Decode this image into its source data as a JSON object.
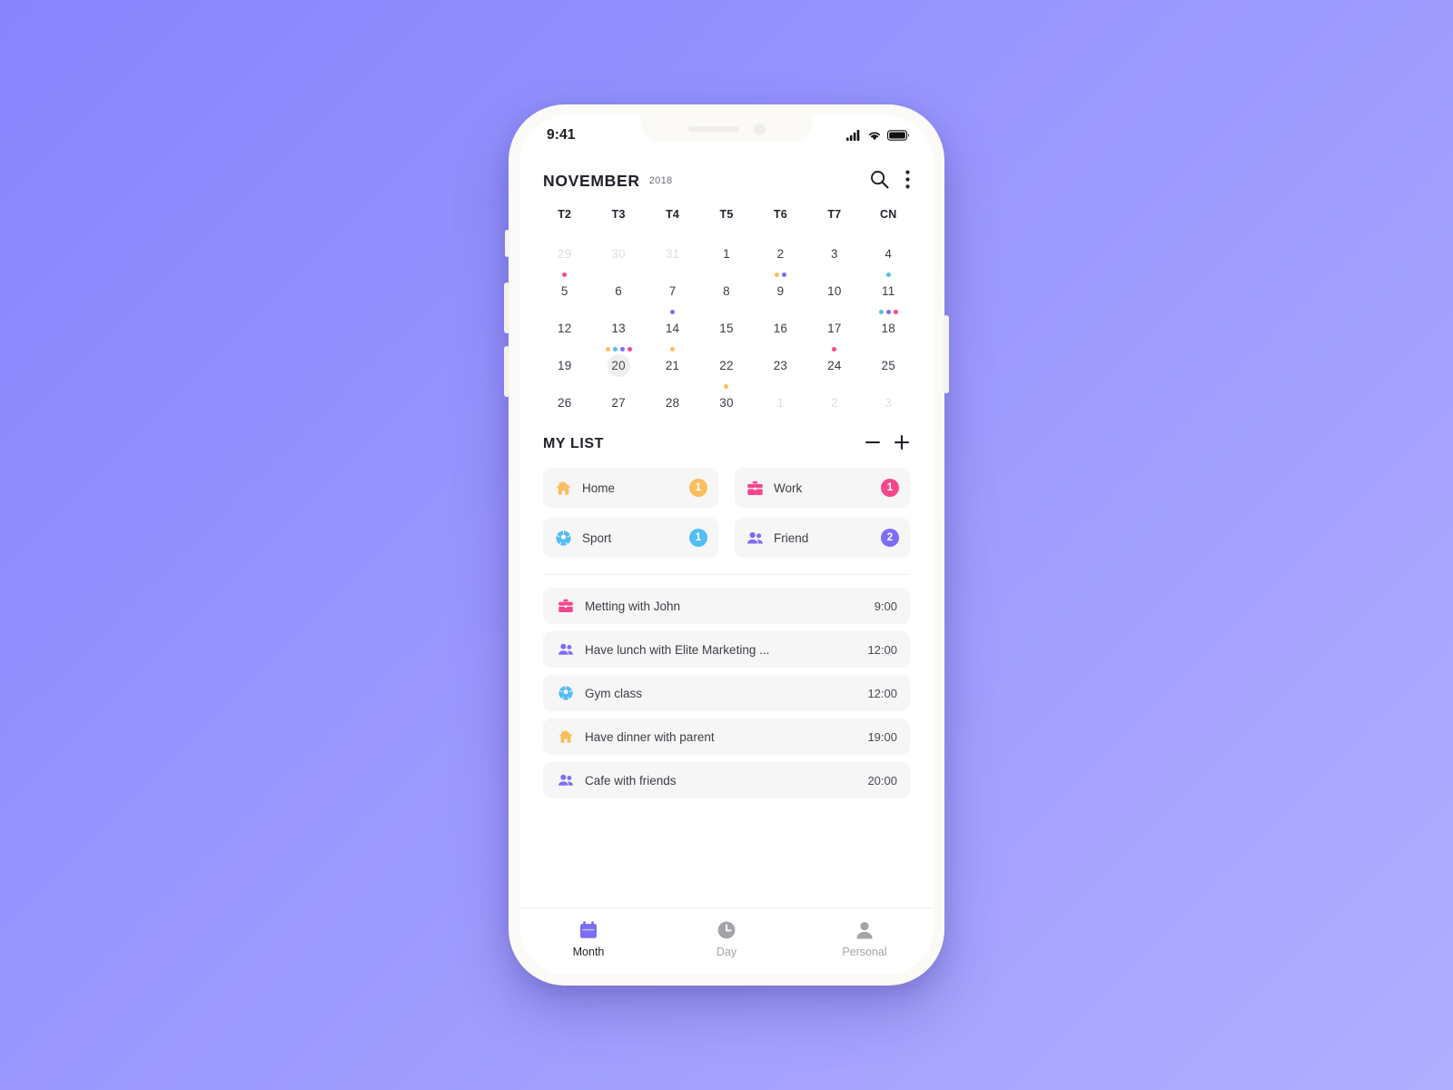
{
  "background": {
    "from": "#8784fd",
    "to": "#b0aeff"
  },
  "status_bar": {
    "time": "9:41",
    "icons": [
      "signal-icon",
      "wifi-icon",
      "battery-icon"
    ]
  },
  "calendar": {
    "month": "NOVEMBER",
    "year": "2018",
    "search_icon": "search-icon",
    "more_icon": "more-vertical-icon",
    "weekdays": [
      "T2",
      "T3",
      "T4",
      "T5",
      "T6",
      "T7",
      "CN"
    ],
    "selected_day": "20",
    "dot_colors": {
      "home": "#fbbe5e",
      "work": "#f6478d",
      "sport": "#53bdf5",
      "friend": "#7c6df6"
    },
    "days": [
      {
        "label": "29",
        "muted": true,
        "selected": false,
        "dots": []
      },
      {
        "label": "30",
        "muted": true,
        "selected": false,
        "dots": []
      },
      {
        "label": "31",
        "muted": true,
        "selected": false,
        "dots": []
      },
      {
        "label": "1",
        "muted": false,
        "selected": false,
        "dots": []
      },
      {
        "label": "2",
        "muted": false,
        "selected": false,
        "dots": []
      },
      {
        "label": "3",
        "muted": false,
        "selected": false,
        "dots": []
      },
      {
        "label": "4",
        "muted": false,
        "selected": false,
        "dots": []
      },
      {
        "label": "5",
        "muted": false,
        "selected": false,
        "dots": [
          "#f6478d"
        ]
      },
      {
        "label": "6",
        "muted": false,
        "selected": false,
        "dots": []
      },
      {
        "label": "7",
        "muted": false,
        "selected": false,
        "dots": []
      },
      {
        "label": "8",
        "muted": false,
        "selected": false,
        "dots": []
      },
      {
        "label": "9",
        "muted": false,
        "selected": false,
        "dots": [
          "#fbbe5e",
          "#7c6df6"
        ]
      },
      {
        "label": "10",
        "muted": false,
        "selected": false,
        "dots": []
      },
      {
        "label": "11",
        "muted": false,
        "selected": false,
        "dots": [
          "#53bdf5"
        ]
      },
      {
        "label": "12",
        "muted": false,
        "selected": false,
        "dots": []
      },
      {
        "label": "13",
        "muted": false,
        "selected": false,
        "dots": []
      },
      {
        "label": "14",
        "muted": false,
        "selected": false,
        "dots": [
          "#7c6df6"
        ]
      },
      {
        "label": "15",
        "muted": false,
        "selected": false,
        "dots": []
      },
      {
        "label": "16",
        "muted": false,
        "selected": false,
        "dots": []
      },
      {
        "label": "17",
        "muted": false,
        "selected": false,
        "dots": []
      },
      {
        "label": "18",
        "muted": false,
        "selected": false,
        "dots": [
          "#53bdf5",
          "#7c6df6",
          "#f6478d"
        ]
      },
      {
        "label": "19",
        "muted": false,
        "selected": false,
        "dots": []
      },
      {
        "label": "20",
        "muted": false,
        "selected": true,
        "dots": [
          "#fbbe5e",
          "#53bdf5",
          "#7c6df6",
          "#f6478d"
        ]
      },
      {
        "label": "21",
        "muted": false,
        "selected": false,
        "dots": [
          "#fbbe5e"
        ]
      },
      {
        "label": "22",
        "muted": false,
        "selected": false,
        "dots": []
      },
      {
        "label": "23",
        "muted": false,
        "selected": false,
        "dots": []
      },
      {
        "label": "24",
        "muted": false,
        "selected": false,
        "dots": [
          "#f6478d"
        ]
      },
      {
        "label": "25",
        "muted": false,
        "selected": false,
        "dots": []
      },
      {
        "label": "26",
        "muted": false,
        "selected": false,
        "dots": []
      },
      {
        "label": "27",
        "muted": false,
        "selected": false,
        "dots": []
      },
      {
        "label": "28",
        "muted": false,
        "selected": false,
        "dots": []
      },
      {
        "label": "30",
        "muted": false,
        "selected": false,
        "dots": [
          "#fbbe5e"
        ]
      },
      {
        "label": "1",
        "muted": true,
        "selected": false,
        "dots": []
      },
      {
        "label": "2",
        "muted": true,
        "selected": false,
        "dots": []
      },
      {
        "label": "3",
        "muted": true,
        "selected": false,
        "dots": []
      }
    ]
  },
  "mylist": {
    "title": "MY LIST",
    "minus_label": "−",
    "plus_label": "+",
    "categories": [
      {
        "label": "Home",
        "count": "1",
        "color": "#fbbe5e",
        "icon": "home-icon"
      },
      {
        "label": "Work",
        "count": "1",
        "color": "#f6478d",
        "icon": "briefcase-icon"
      },
      {
        "label": "Sport",
        "count": "1",
        "color": "#53bdf5",
        "icon": "soccer-ball-icon"
      },
      {
        "label": "Friend",
        "count": "2",
        "color": "#7c6df6",
        "icon": "people-icon"
      }
    ]
  },
  "events": [
    {
      "title": "Metting with John",
      "time": "9:00",
      "color": "#f6478d",
      "icon": "briefcase-icon"
    },
    {
      "title": "Have lunch with Elite Marketing ...",
      "time": "12:00",
      "color": "#7c6df6",
      "icon": "people-icon"
    },
    {
      "title": "Gym class",
      "time": "12:00",
      "color": "#53bdf5",
      "icon": "soccer-ball-icon"
    },
    {
      "title": "Have dinner with parent",
      "time": "19:00",
      "color": "#fbbe5e",
      "icon": "home-icon"
    },
    {
      "title": "Cafe with friends",
      "time": "20:00",
      "color": "#7c6df6",
      "icon": "people-icon"
    }
  ],
  "bottom_nav": {
    "items": [
      {
        "label": "Month",
        "icon": "calendar-icon",
        "active": true,
        "color": "#7c6df6"
      },
      {
        "label": "Day",
        "icon": "clock-icon",
        "active": false,
        "color": "#a3a3a9"
      },
      {
        "label": "Personal",
        "icon": "person-icon",
        "active": false,
        "color": "#a3a3a9"
      }
    ]
  }
}
